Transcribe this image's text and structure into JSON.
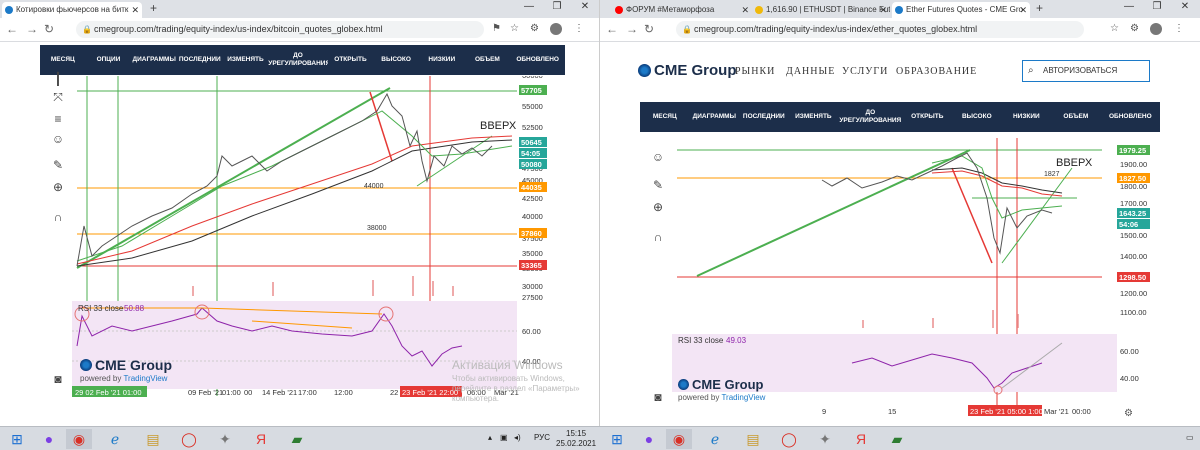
{
  "left_window": {
    "tabs": [
      {
        "label": "Котировки фьючерсов на битк",
        "active": true,
        "favicon_color": "#1c7ac8"
      }
    ],
    "url": "cmegroup.com/trading/equity-index/us-index/bitcoin_quotes_globex.html",
    "table_header": [
      "МЕСЯЦ",
      "ОПЦИИ",
      "ДИАГРАММЫ",
      "ПОСЛЕДНИЙ",
      "ИЗМЕНЯТЬ",
      "ДО УРЕГУЛИРОВАНИЯ",
      "ОТКРЫТЬ",
      "ВЫСОКО",
      "НИЗКИЙ",
      "ОБЪЕМ",
      "ОБНОВЛЕНО"
    ],
    "chart": {
      "annotation": "ВВЕРХ",
      "level_labels": [
        "44000",
        "38000"
      ],
      "y_ticks": [
        "60000",
        "55000",
        "52500",
        "50000",
        "47500",
        "45000",
        "42500",
        "40000",
        "37500",
        "35000",
        "32500",
        "30000",
        "27500"
      ],
      "price_labels": [
        {
          "text": "57705",
          "color": "#4caf50"
        },
        {
          "text": "50645",
          "color": "#26a69a"
        },
        {
          "text": "54:05",
          "color": "#26a69a"
        },
        {
          "text": "50080",
          "color": "#26a69a"
        },
        {
          "text": "44035",
          "color": "#ff9800"
        },
        {
          "text": "37860",
          "color": "#ff9800"
        },
        {
          "text": "33365",
          "color": "#e53935"
        }
      ],
      "rsi_label": "RSI 33 close",
      "rsi_value": "50.88",
      "rsi_ticks": [
        "60.00",
        "40.00"
      ],
      "x_ticks": [
        "29",
        "02 Feb '21",
        "01:00",
        "00",
        "09 Feb '21",
        "01:00",
        "00",
        "14 Feb '21",
        "17:00",
        "12:00",
        "22",
        "23 Feb '21",
        "22:00",
        "06:00",
        "Mar '21"
      ],
      "x_highlight_1": "29 02 Feb '21  01:00",
      "x_highlight_2": "23 Feb '21  22:00"
    },
    "brand": "CME Group",
    "powered": "powered by",
    "tradingview": "TradingView",
    "watermark_line1": "Активация Windows",
    "watermark_line2": "Чтобы активировать Windows,",
    "watermark_line3": "перейдите в раздел «Параметры»",
    "watermark_line4": "компьютера."
  },
  "right_window": {
    "tabs": [
      {
        "label": "ФОРУМ #Метаморфоза",
        "active": false,
        "favicon_color": "#ff0000"
      },
      {
        "label": "1,616.90 | ETHUSDT | Binance Fut",
        "active": false,
        "favicon_color": "#f0b90b"
      },
      {
        "label": "Ether Futures Quotes - CME Gro",
        "active": true,
        "favicon_color": "#1c7ac8"
      }
    ],
    "url": "cmegroup.com/trading/equity-index/us-index/ether_quotes_globex.html",
    "site_nav": [
      "РЫНКИ",
      "ДАННЫЕ",
      "УСЛУГИ",
      "ОБРАЗОВАНИЕ"
    ],
    "login_label": "АВТОРИЗОВАТЬСЯ",
    "table_header": [
      "МЕСЯЦ",
      "ДИАГРАММЫ",
      "ПОСЛЕДНИЙ",
      "ИЗМЕНЯТЬ",
      "ДО УРЕГУЛИРОВАНИЯ",
      "ОТКРЫТЬ",
      "ВЫСОКО",
      "НИЗКИЙ",
      "ОБЪЕМ",
      "ОБНОВЛЕНО"
    ],
    "chart": {
      "annotation": "ВВЕРХ",
      "level_label": "1827",
      "y_ticks": [
        "1900.00",
        "1800.00",
        "1700.00",
        "1600.00",
        "1500.00",
        "1400.00",
        "1300.00",
        "1200.00",
        "1100.00"
      ],
      "price_labels": [
        {
          "text": "1979.25",
          "color": "#4caf50"
        },
        {
          "text": "1827.50",
          "color": "#ff9800"
        },
        {
          "text": "1643.25",
          "color": "#26a69a"
        },
        {
          "text": "54:06",
          "color": "#26a69a"
        },
        {
          "text": "1298.50",
          "color": "#e53935"
        }
      ],
      "rsi_label": "RSI 33 close",
      "rsi_value": "49.03",
      "rsi_ticks": [
        "60.00",
        "40.00"
      ],
      "x_ticks": [
        "9",
        "15",
        "23 Feb '21",
        "05:00",
        "Mar '21",
        "00:00"
      ],
      "x_highlight": "23 Feb '21  05:00  1:00"
    },
    "brand": "CME Group",
    "powered": "powered by",
    "tradingview": "TradingView"
  },
  "taskbar": {
    "lang": "РУС",
    "time": "15:15",
    "date": "25.02.2021"
  }
}
